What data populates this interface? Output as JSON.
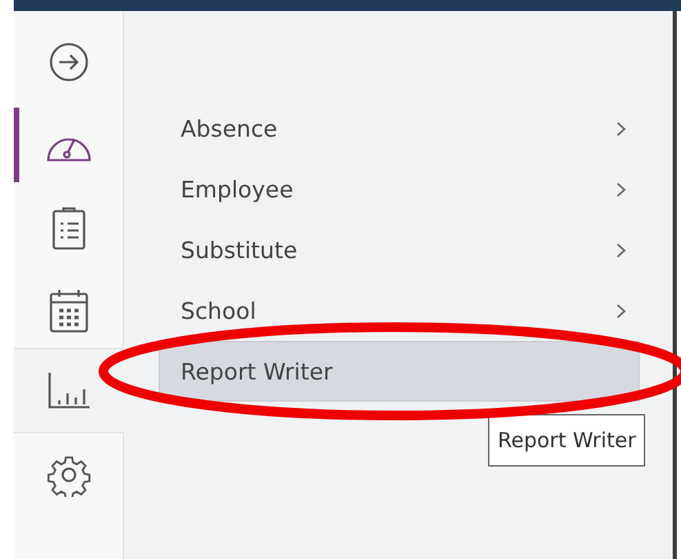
{
  "sidebar": {
    "items": [
      {
        "kind": "arrow",
        "selected": false,
        "expanded": false
      },
      {
        "kind": "gauge",
        "selected": true,
        "expanded": false
      },
      {
        "kind": "clipboard",
        "selected": false,
        "expanded": false
      },
      {
        "kind": "calendar",
        "selected": false,
        "expanded": false
      },
      {
        "kind": "chart",
        "selected": false,
        "expanded": true
      },
      {
        "kind": "gear",
        "selected": false,
        "expanded": false
      }
    ]
  },
  "menu": {
    "items": [
      {
        "label": "Absence",
        "submenu": true,
        "selected": false
      },
      {
        "label": "Employee",
        "submenu": true,
        "selected": false
      },
      {
        "label": "Substitute",
        "submenu": true,
        "selected": false
      },
      {
        "label": "School",
        "submenu": true,
        "selected": false
      },
      {
        "label": "Report Writer",
        "submenu": false,
        "selected": true
      }
    ]
  },
  "tooltip": {
    "text": "Report Writer"
  }
}
